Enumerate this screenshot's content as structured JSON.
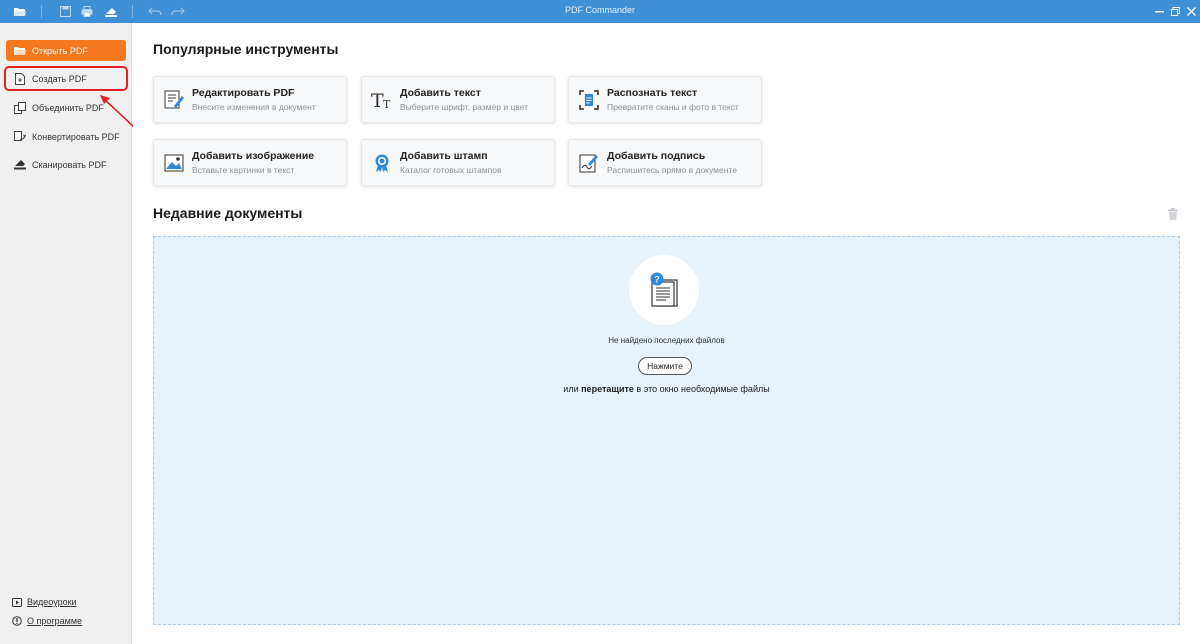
{
  "window": {
    "title": "PDF Commander"
  },
  "toolbar": {
    "icons": [
      "open-folder-icon",
      "save-icon",
      "print-icon",
      "scan-icon",
      "undo-icon",
      "redo-icon",
      "minimize-icon",
      "restore-icon",
      "close-icon"
    ]
  },
  "sidebar": {
    "items": [
      {
        "label": "Открыть PDF",
        "icon": "open-folder-icon",
        "active": true
      },
      {
        "label": "Создать PDF",
        "icon": "new-document-icon",
        "highlighted": true
      },
      {
        "label": "Объединить PDF",
        "icon": "merge-icon"
      },
      {
        "label": "Конвертировать PDF",
        "icon": "convert-icon"
      },
      {
        "label": "Сканировать PDF",
        "icon": "scanner-icon"
      }
    ],
    "bottom": [
      {
        "label": "Видеоуроки",
        "icon": "video-icon"
      },
      {
        "label": "О программе",
        "icon": "info-icon"
      }
    ]
  },
  "main": {
    "tools_heading": "Популярные инструменты",
    "tools": [
      {
        "title": "Редактировать PDF",
        "subtitle": "Внесите изменения в документ",
        "icon": "edit-pdf-icon"
      },
      {
        "title": "Добавить текст",
        "subtitle": "Выберите шрифт, размер и цвет",
        "icon": "text-icon"
      },
      {
        "title": "Распознать текст",
        "subtitle": "Превратите сканы и фото в текст",
        "icon": "ocr-icon"
      },
      {
        "title": "Добавить изображение",
        "subtitle": "Вставьте картинки в текст",
        "icon": "image-icon"
      },
      {
        "title": "Добавить штамп",
        "subtitle": "Каталог готовых штампов",
        "icon": "stamp-icon"
      },
      {
        "title": "Добавить подпись",
        "subtitle": "Распишитесь прямо в документе",
        "icon": "signature-icon"
      }
    ],
    "recent_heading": "Недавние документы",
    "recent": {
      "empty_text": "Не найдено последних файлов",
      "button_label": "Нажмите",
      "drag_prefix": "или",
      "drag_bold": "перетащите",
      "drag_suffix": "в это окно необходимые файлы"
    }
  },
  "colors": {
    "titlebar": "#3f8fd6",
    "accent_orange": "#f5781f",
    "highlight_red": "#e32222",
    "dropzone_bg": "#e7f2fb"
  }
}
